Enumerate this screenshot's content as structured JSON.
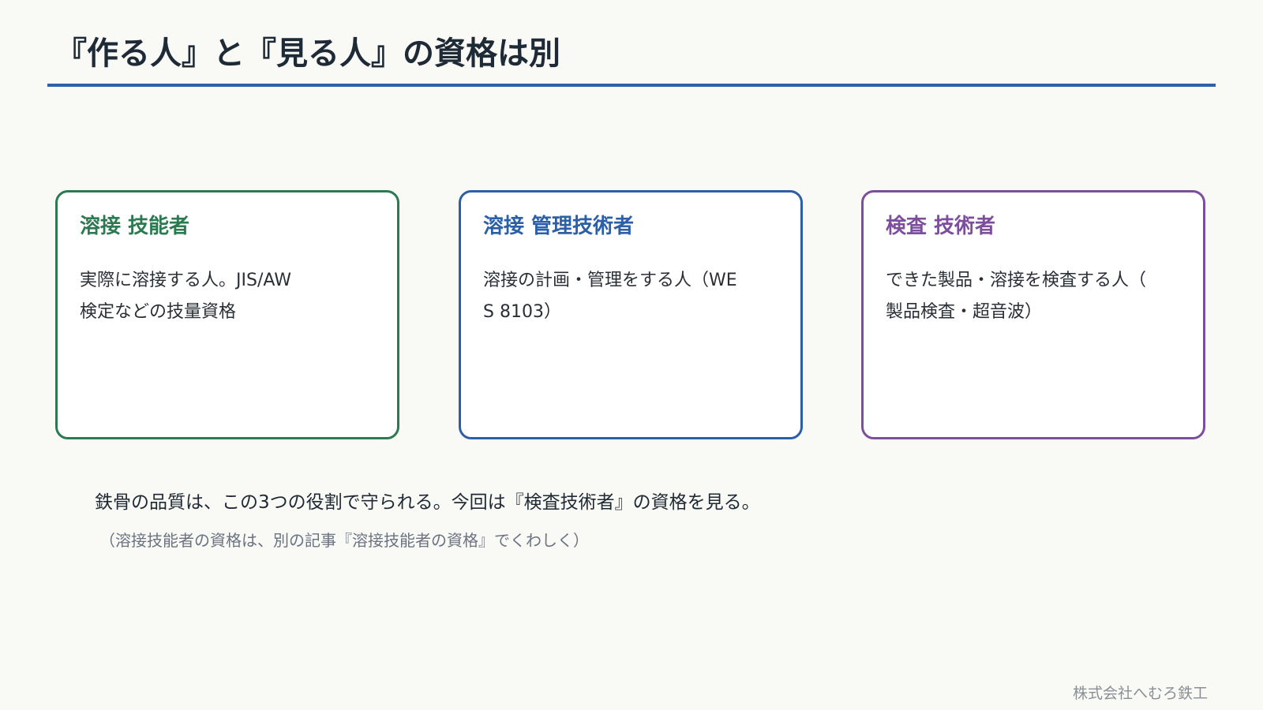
{
  "page": {
    "title": "『作る人』と『見る人』の資格は別",
    "accent_color": "#2b62a8"
  },
  "cards": [
    {
      "title": "溶接 技能者",
      "lines": [
        "実際に溶接する人。JIS/AW",
        "検定などの技量資格"
      ],
      "color": "#2c7a52"
    },
    {
      "title": "溶接 管理技術者",
      "lines": [
        "溶接の計画・管理をする人（WE",
        "S 8103）"
      ],
      "color": "#2b5fa8"
    },
    {
      "title": "検査 技術者",
      "lines": [
        "できた製品・溶接を検査する人（",
        "製品検査・超音波）"
      ],
      "color": "#7d4e9c"
    }
  ],
  "summary": "鉄骨の品質は、この3つの役割で守られる。今回は『検査技術者』の資格を見る。",
  "note": "（溶接技能者の資格は、別の記事『溶接技能者の資格』でくわしく）",
  "footer": "株式会社へむろ鉄工"
}
